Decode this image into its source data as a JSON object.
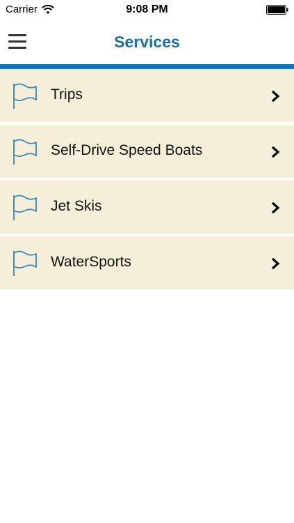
{
  "status_bar": {
    "carrier": "Carrier",
    "time": "9:08 PM"
  },
  "nav": {
    "title": "Services",
    "accent_color": "#1c73b5",
    "title_color": "#1c6ea4"
  },
  "services": {
    "row_background": "#f5eed9",
    "items": [
      {
        "label": "Trips",
        "icon": "flag-icon"
      },
      {
        "label": "Self-Drive Speed Boats",
        "icon": "flag-icon"
      },
      {
        "label": "Jet Skis",
        "icon": "flag-icon"
      },
      {
        "label": "WaterSports",
        "icon": "flag-icon"
      }
    ]
  }
}
